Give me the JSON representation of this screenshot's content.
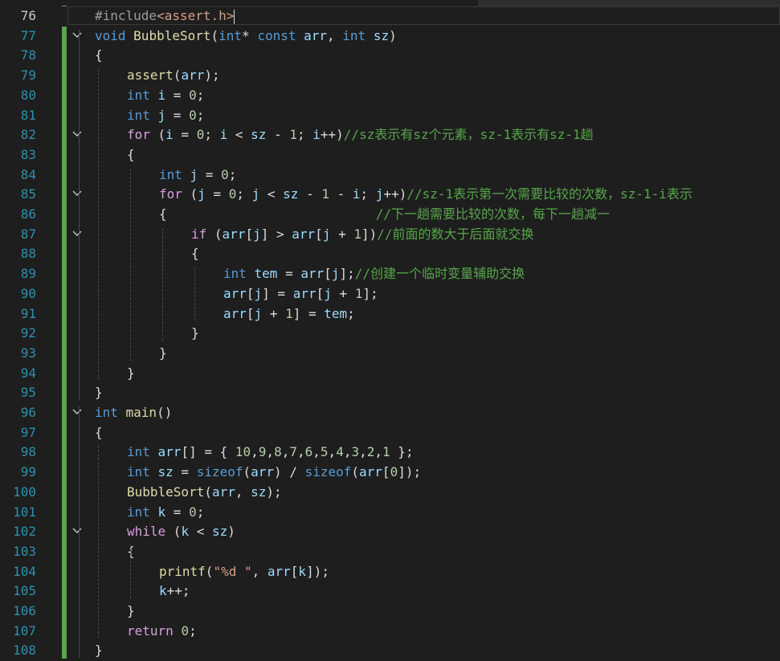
{
  "editor": {
    "current_line": 76,
    "lines": [
      {
        "n": "76",
        "fold": "",
        "indent": 0,
        "tokens": [
          {
            "t": "pp",
            "v": "#include"
          },
          {
            "t": "inc",
            "v": "<assert.h>"
          }
        ]
      },
      {
        "n": "77",
        "fold": "v",
        "indent": 0,
        "tokens": [
          {
            "t": "kw",
            "v": "void "
          },
          {
            "t": "fn",
            "v": "BubbleSort"
          },
          {
            "t": "txt",
            "v": "("
          },
          {
            "t": "kw",
            "v": "int"
          },
          {
            "t": "txt",
            "v": "* "
          },
          {
            "t": "kw",
            "v": "const "
          },
          {
            "t": "var",
            "v": "arr"
          },
          {
            "t": "txt",
            "v": ", "
          },
          {
            "t": "kw",
            "v": "int "
          },
          {
            "t": "var",
            "v": "sz"
          },
          {
            "t": "txt",
            "v": ")"
          }
        ]
      },
      {
        "n": "78",
        "fold": "",
        "indent": 0,
        "tokens": [
          {
            "t": "txt",
            "v": "{"
          }
        ]
      },
      {
        "n": "79",
        "fold": "",
        "indent": 1,
        "tokens": [
          {
            "t": "fn",
            "v": "assert"
          },
          {
            "t": "txt",
            "v": "("
          },
          {
            "t": "var",
            "v": "arr"
          },
          {
            "t": "txt",
            "v": ");"
          }
        ]
      },
      {
        "n": "80",
        "fold": "",
        "indent": 1,
        "tokens": [
          {
            "t": "kw",
            "v": "int "
          },
          {
            "t": "var",
            "v": "i"
          },
          {
            "t": "txt",
            "v": " = "
          },
          {
            "t": "num",
            "v": "0"
          },
          {
            "t": "txt",
            "v": ";"
          }
        ]
      },
      {
        "n": "81",
        "fold": "",
        "indent": 1,
        "tokens": [
          {
            "t": "kw",
            "v": "int "
          },
          {
            "t": "var",
            "v": "j"
          },
          {
            "t": "txt",
            "v": " = "
          },
          {
            "t": "num",
            "v": "0"
          },
          {
            "t": "txt",
            "v": ";"
          }
        ]
      },
      {
        "n": "82",
        "fold": "v",
        "indent": 1,
        "tokens": [
          {
            "t": "kw2",
            "v": "for "
          },
          {
            "t": "txt",
            "v": "("
          },
          {
            "t": "var",
            "v": "i"
          },
          {
            "t": "txt",
            "v": " = "
          },
          {
            "t": "num",
            "v": "0"
          },
          {
            "t": "txt",
            "v": "; "
          },
          {
            "t": "var",
            "v": "i"
          },
          {
            "t": "txt",
            "v": " < "
          },
          {
            "t": "var",
            "v": "sz"
          },
          {
            "t": "txt",
            "v": " - "
          },
          {
            "t": "num",
            "v": "1"
          },
          {
            "t": "txt",
            "v": "; "
          },
          {
            "t": "var",
            "v": "i"
          },
          {
            "t": "txt",
            "v": "++)"
          },
          {
            "t": "cm",
            "v": "//sz表示有sz个元素，sz-1表示有sz-1趟"
          }
        ]
      },
      {
        "n": "83",
        "fold": "",
        "indent": 1,
        "tokens": [
          {
            "t": "txt",
            "v": "{"
          }
        ]
      },
      {
        "n": "84",
        "fold": "",
        "indent": 2,
        "tokens": [
          {
            "t": "kw",
            "v": "int "
          },
          {
            "t": "var",
            "v": "j"
          },
          {
            "t": "txt",
            "v": " = "
          },
          {
            "t": "num",
            "v": "0"
          },
          {
            "t": "txt",
            "v": ";"
          }
        ]
      },
      {
        "n": "85",
        "fold": "v",
        "indent": 2,
        "tokens": [
          {
            "t": "kw2",
            "v": "for "
          },
          {
            "t": "txt",
            "v": "("
          },
          {
            "t": "var",
            "v": "j"
          },
          {
            "t": "txt",
            "v": " = "
          },
          {
            "t": "num",
            "v": "0"
          },
          {
            "t": "txt",
            "v": "; "
          },
          {
            "t": "var",
            "v": "j"
          },
          {
            "t": "txt",
            "v": " < "
          },
          {
            "t": "var",
            "v": "sz"
          },
          {
            "t": "txt",
            "v": " - "
          },
          {
            "t": "num",
            "v": "1"
          },
          {
            "t": "txt",
            "v": " - "
          },
          {
            "t": "var",
            "v": "i"
          },
          {
            "t": "txt",
            "v": "; "
          },
          {
            "t": "var",
            "v": "j"
          },
          {
            "t": "txt",
            "v": "++)"
          },
          {
            "t": "cm",
            "v": "//sz-1表示第一次需要比较的次数，sz-1-i表示"
          }
        ]
      },
      {
        "n": "86",
        "fold": "",
        "indent": 2,
        "tokens": [
          {
            "t": "txt",
            "v": "{                           "
          },
          {
            "t": "cm",
            "v": "//下一趟需要比较的次数，每下一趟减一"
          }
        ]
      },
      {
        "n": "87",
        "fold": "v",
        "indent": 3,
        "tokens": [
          {
            "t": "kw2",
            "v": "if "
          },
          {
            "t": "txt",
            "v": "("
          },
          {
            "t": "var",
            "v": "arr"
          },
          {
            "t": "txt",
            "v": "["
          },
          {
            "t": "var",
            "v": "j"
          },
          {
            "t": "txt",
            "v": "] > "
          },
          {
            "t": "var",
            "v": "arr"
          },
          {
            "t": "txt",
            "v": "["
          },
          {
            "t": "var",
            "v": "j"
          },
          {
            "t": "txt",
            "v": " + "
          },
          {
            "t": "num",
            "v": "1"
          },
          {
            "t": "txt",
            "v": "])"
          },
          {
            "t": "cm",
            "v": "//前面的数大于后面就交换"
          }
        ]
      },
      {
        "n": "88",
        "fold": "",
        "indent": 3,
        "tokens": [
          {
            "t": "txt",
            "v": "{"
          }
        ]
      },
      {
        "n": "89",
        "fold": "",
        "indent": 4,
        "tokens": [
          {
            "t": "kw",
            "v": "int "
          },
          {
            "t": "var",
            "v": "tem"
          },
          {
            "t": "txt",
            "v": " = "
          },
          {
            "t": "var",
            "v": "arr"
          },
          {
            "t": "txt",
            "v": "["
          },
          {
            "t": "var",
            "v": "j"
          },
          {
            "t": "txt",
            "v": "];"
          },
          {
            "t": "cm",
            "v": "//创建一个临时变量辅助交换"
          }
        ]
      },
      {
        "n": "90",
        "fold": "",
        "indent": 4,
        "tokens": [
          {
            "t": "var",
            "v": "arr"
          },
          {
            "t": "txt",
            "v": "["
          },
          {
            "t": "var",
            "v": "j"
          },
          {
            "t": "txt",
            "v": "] = "
          },
          {
            "t": "var",
            "v": "arr"
          },
          {
            "t": "txt",
            "v": "["
          },
          {
            "t": "var",
            "v": "j"
          },
          {
            "t": "txt",
            "v": " + "
          },
          {
            "t": "num",
            "v": "1"
          },
          {
            "t": "txt",
            "v": "];"
          }
        ]
      },
      {
        "n": "91",
        "fold": "",
        "indent": 4,
        "tokens": [
          {
            "t": "var",
            "v": "arr"
          },
          {
            "t": "txt",
            "v": "["
          },
          {
            "t": "var",
            "v": "j"
          },
          {
            "t": "txt",
            "v": " + "
          },
          {
            "t": "num",
            "v": "1"
          },
          {
            "t": "txt",
            "v": "] = "
          },
          {
            "t": "var",
            "v": "tem"
          },
          {
            "t": "txt",
            "v": ";"
          }
        ]
      },
      {
        "n": "92",
        "fold": "",
        "indent": 3,
        "tokens": [
          {
            "t": "txt",
            "v": "}"
          }
        ]
      },
      {
        "n": "93",
        "fold": "",
        "indent": 2,
        "tokens": [
          {
            "t": "txt",
            "v": "}"
          }
        ]
      },
      {
        "n": "94",
        "fold": "",
        "indent": 1,
        "tokens": [
          {
            "t": "txt",
            "v": "}"
          }
        ]
      },
      {
        "n": "95",
        "fold": "",
        "indent": 0,
        "tokens": [
          {
            "t": "txt",
            "v": "}"
          }
        ]
      },
      {
        "n": "96",
        "fold": "v",
        "indent": 0,
        "tokens": [
          {
            "t": "kw",
            "v": "int "
          },
          {
            "t": "fn",
            "v": "main"
          },
          {
            "t": "txt",
            "v": "()"
          }
        ]
      },
      {
        "n": "97",
        "fold": "",
        "indent": 0,
        "tokens": [
          {
            "t": "txt",
            "v": "{"
          }
        ]
      },
      {
        "n": "98",
        "fold": "",
        "indent": 1,
        "tokens": [
          {
            "t": "kw",
            "v": "int "
          },
          {
            "t": "var",
            "v": "arr"
          },
          {
            "t": "txt",
            "v": "[] = { "
          },
          {
            "t": "num",
            "v": "10"
          },
          {
            "t": "txt",
            "v": ","
          },
          {
            "t": "num",
            "v": "9"
          },
          {
            "t": "txt",
            "v": ","
          },
          {
            "t": "num",
            "v": "8"
          },
          {
            "t": "txt",
            "v": ","
          },
          {
            "t": "num",
            "v": "7"
          },
          {
            "t": "txt",
            "v": ","
          },
          {
            "t": "num",
            "v": "6"
          },
          {
            "t": "txt",
            "v": ","
          },
          {
            "t": "num",
            "v": "5"
          },
          {
            "t": "txt",
            "v": ","
          },
          {
            "t": "num",
            "v": "4"
          },
          {
            "t": "txt",
            "v": ","
          },
          {
            "t": "num",
            "v": "3"
          },
          {
            "t": "txt",
            "v": ","
          },
          {
            "t": "num",
            "v": "2"
          },
          {
            "t": "txt",
            "v": ","
          },
          {
            "t": "num",
            "v": "1"
          },
          {
            "t": "txt",
            "v": " };"
          }
        ]
      },
      {
        "n": "99",
        "fold": "",
        "indent": 1,
        "tokens": [
          {
            "t": "kw",
            "v": "int "
          },
          {
            "t": "var",
            "v": "sz"
          },
          {
            "t": "txt",
            "v": " = "
          },
          {
            "t": "kw",
            "v": "sizeof"
          },
          {
            "t": "txt",
            "v": "("
          },
          {
            "t": "var",
            "v": "arr"
          },
          {
            "t": "txt",
            "v": ") / "
          },
          {
            "t": "kw",
            "v": "sizeof"
          },
          {
            "t": "txt",
            "v": "("
          },
          {
            "t": "var",
            "v": "arr"
          },
          {
            "t": "txt",
            "v": "["
          },
          {
            "t": "num",
            "v": "0"
          },
          {
            "t": "txt",
            "v": "]);"
          }
        ]
      },
      {
        "n": "100",
        "fold": "",
        "indent": 1,
        "tokens": [
          {
            "t": "fn",
            "v": "BubbleSort"
          },
          {
            "t": "txt",
            "v": "("
          },
          {
            "t": "var",
            "v": "arr"
          },
          {
            "t": "txt",
            "v": ", "
          },
          {
            "t": "var",
            "v": "sz"
          },
          {
            "t": "txt",
            "v": ");"
          }
        ]
      },
      {
        "n": "101",
        "fold": "",
        "indent": 1,
        "tokens": [
          {
            "t": "kw",
            "v": "int "
          },
          {
            "t": "var",
            "v": "k"
          },
          {
            "t": "txt",
            "v": " = "
          },
          {
            "t": "num",
            "v": "0"
          },
          {
            "t": "txt",
            "v": ";"
          }
        ]
      },
      {
        "n": "102",
        "fold": "v",
        "indent": 1,
        "tokens": [
          {
            "t": "kw2",
            "v": "while "
          },
          {
            "t": "txt",
            "v": "("
          },
          {
            "t": "var",
            "v": "k"
          },
          {
            "t": "txt",
            "v": " < "
          },
          {
            "t": "var",
            "v": "sz"
          },
          {
            "t": "txt",
            "v": ")"
          }
        ]
      },
      {
        "n": "103",
        "fold": "",
        "indent": 1,
        "tokens": [
          {
            "t": "txt",
            "v": "{"
          }
        ]
      },
      {
        "n": "104",
        "fold": "",
        "indent": 2,
        "tokens": [
          {
            "t": "fn",
            "v": "printf"
          },
          {
            "t": "txt",
            "v": "("
          },
          {
            "t": "str",
            "v": "\"%d \""
          },
          {
            "t": "txt",
            "v": ", "
          },
          {
            "t": "var",
            "v": "arr"
          },
          {
            "t": "txt",
            "v": "["
          },
          {
            "t": "var",
            "v": "k"
          },
          {
            "t": "txt",
            "v": "]);"
          }
        ]
      },
      {
        "n": "105",
        "fold": "",
        "indent": 2,
        "tokens": [
          {
            "t": "var",
            "v": "k"
          },
          {
            "t": "txt",
            "v": "++;"
          }
        ]
      },
      {
        "n": "106",
        "fold": "",
        "indent": 1,
        "tokens": [
          {
            "t": "txt",
            "v": "}"
          }
        ]
      },
      {
        "n": "107",
        "fold": "",
        "indent": 1,
        "tokens": [
          {
            "t": "kw2",
            "v": "return "
          },
          {
            "t": "num",
            "v": "0"
          },
          {
            "t": "txt",
            "v": ";"
          }
        ]
      },
      {
        "n": "108",
        "fold": "",
        "indent": 0,
        "tokens": [
          {
            "t": "txt",
            "v": "}"
          }
        ]
      }
    ]
  }
}
